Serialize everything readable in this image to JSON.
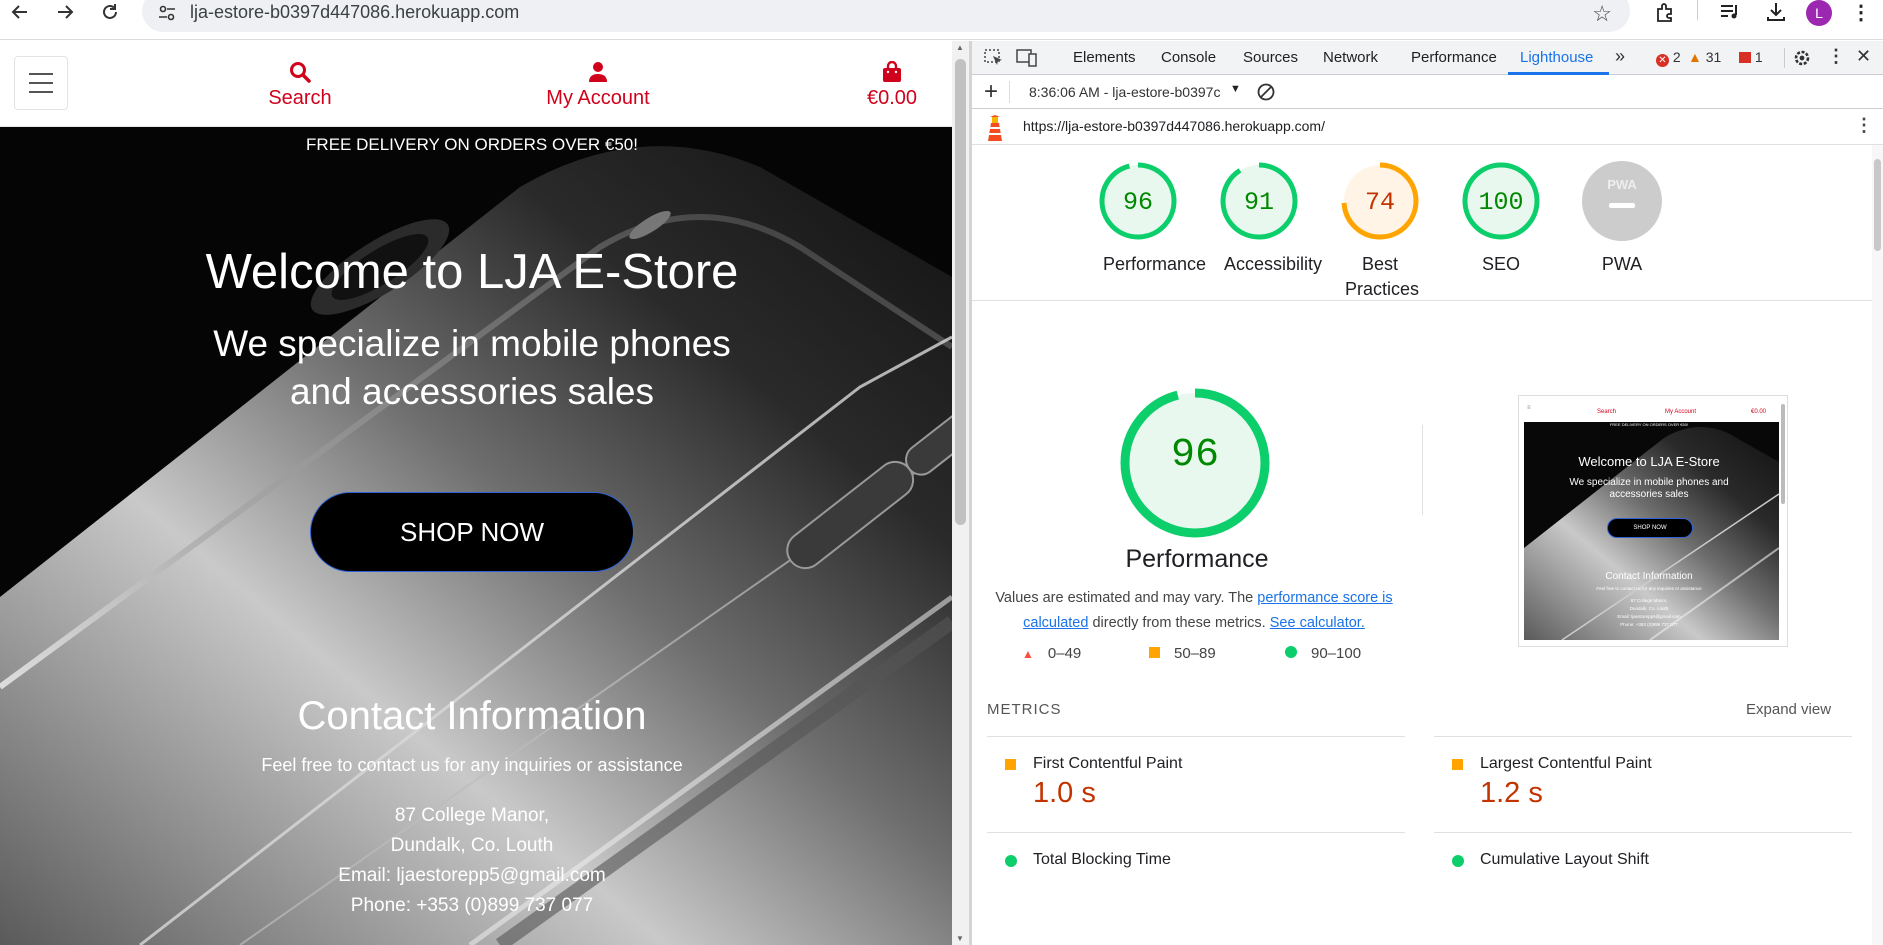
{
  "browser": {
    "url": "lja-estore-b0397d447086.herokuapp.com",
    "avatar_letter": "L"
  },
  "site": {
    "header": {
      "search_label": "Search",
      "account_label": "My Account",
      "cart_total": "€0.00"
    },
    "banner": "FREE DELIVERY ON ORDERS OVER €50!",
    "hero": {
      "title": "Welcome to LJA E-Store",
      "subtitle_line1": "We specialize in mobile phones",
      "subtitle_line2": "and accessories sales",
      "cta": "SHOP NOW"
    },
    "contact": {
      "title": "Contact Information",
      "intro": "Feel free to contact us for any inquiries or assistance",
      "address1": "87 College Manor,",
      "address2": "Dundalk, Co. Louth",
      "email": "Email: ljaestorepp5@gmail.com",
      "phone": "Phone: +353 (0)899 737 077"
    }
  },
  "devtools": {
    "tabs": [
      "Elements",
      "Console",
      "Sources",
      "Network",
      "Performance",
      "Lighthouse"
    ],
    "active_tab": "Lighthouse",
    "errors": "2",
    "warnings": "31",
    "issues": "1",
    "report_select": "8:36:06 AM - lja-estore-b0397c",
    "report_url": "https://lja-estore-b0397d447086.herokuapp.com/",
    "scores": [
      {
        "label": "Performance",
        "score": 96
      },
      {
        "label": "Accessibility",
        "score": 91
      },
      {
        "label": "Best Practices",
        "score": 74
      },
      {
        "label": "SEO",
        "score": 100
      },
      {
        "label": "PWA",
        "score": null
      }
    ],
    "pwa_badge": "PWA",
    "perf": {
      "score": "96",
      "title": "Performance",
      "note_prefix": "Values are estimated and may vary. The ",
      "note_link1": "performance score is calculated",
      "note_mid": " directly from these metrics. ",
      "note_link2": "See calculator."
    },
    "legend": {
      "fail": "0–49",
      "average": "50–89",
      "pass": "90–100"
    },
    "thumbnail": {
      "title": "Welcome to LJA E-Store",
      "subtitle": "We specialize in mobile phones and accessories sales",
      "cta": "SHOP NOW",
      "contact": "Contact Information",
      "search": "Search",
      "account": "My Account",
      "cart": "€0.00",
      "banner": "FREE DELIVERY ON ORDERS OVER €50!",
      "intro": "Feel free to contact us for any inquiries or assistance",
      "address1": "87 College Manor,",
      "address2": "Dundalk, Co. Louth",
      "email": "Email: ljaestorepp5@gmail.com",
      "phone": "Phone: +353 (0)899 737 077"
    },
    "metrics_header": "METRICS",
    "expand_view": "Expand view",
    "metrics": [
      {
        "name": "First Contentful Paint",
        "value": "1.0 s",
        "status": "average"
      },
      {
        "name": "Largest Contentful Paint",
        "value": "1.2 s",
        "status": "average"
      },
      {
        "name": "Total Blocking Time",
        "value": "",
        "status": "pass"
      },
      {
        "name": "Cumulative Layout Shift",
        "value": "",
        "status": "pass"
      }
    ],
    "colors": {
      "pass": "#0cce6b",
      "average": "#ffa400",
      "fail": "#ff4e42",
      "link": "#1a73e8"
    }
  }
}
